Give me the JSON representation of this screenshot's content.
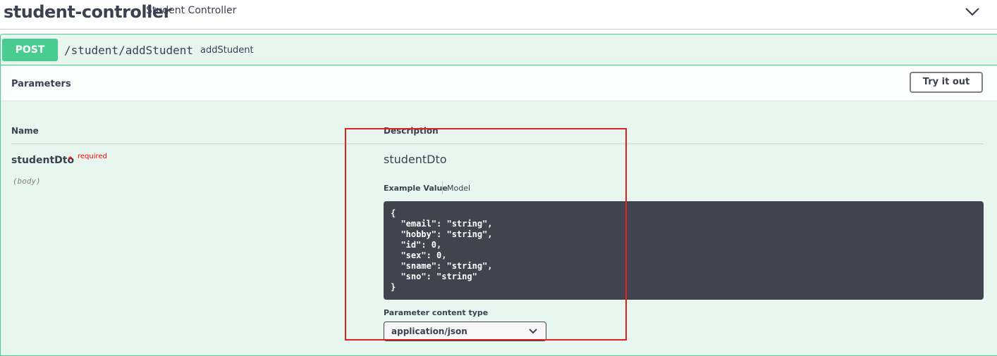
{
  "tag": {
    "name": "student-controller",
    "description": "Student Controller",
    "toggle_icon": "chevron-down-icon"
  },
  "operation": {
    "method": "POST",
    "path": "/student/addStudent",
    "summary": "addStudent"
  },
  "parameters_section": {
    "title": "Parameters",
    "try_button_label": "Try it out",
    "column_headers": {
      "name": "Name",
      "description": "Description"
    },
    "params": [
      {
        "name": "studentDto",
        "required_star": "*",
        "required_label": "required",
        "in": "(body)",
        "description": "studentDto",
        "tabs": {
          "example_value": "Example Value",
          "model": "Model"
        },
        "example_json": "{\n  \"email\": \"string\",\n  \"hobby\": \"string\",\n  \"id\": 0,\n  \"sex\": 0,\n  \"sname\": \"string\",\n  \"sno\": \"string\"\n}",
        "content_type_label": "Parameter content type",
        "content_type_value": "application/json"
      }
    ]
  },
  "colors": {
    "post_green": "#49cc90",
    "opblock_bg": "#e8f6f0",
    "code_bg": "#41444e",
    "required_red": "#ff0000",
    "annotation_red": "#e02020"
  }
}
